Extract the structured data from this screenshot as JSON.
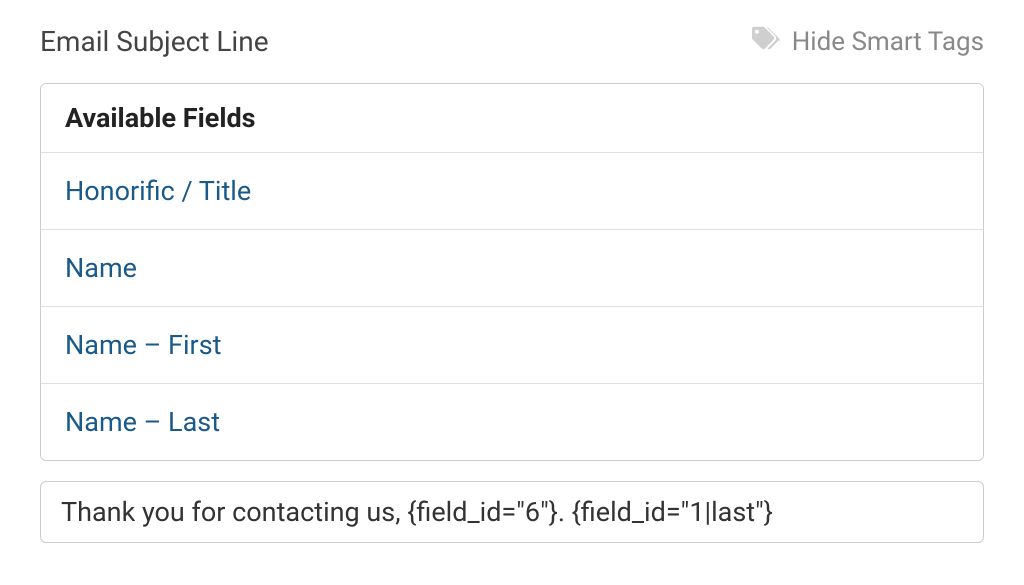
{
  "field": {
    "label": "Email Subject Line",
    "toggle_label": "Hide Smart Tags",
    "value": "Thank you for contacting us, {field_id=\"6\"}. {field_id=\"1|last\"}"
  },
  "smart_tags": {
    "heading": "Available Fields",
    "items": [
      "Honorific / Title",
      "Name",
      "Name – First",
      "Name – Last"
    ]
  }
}
